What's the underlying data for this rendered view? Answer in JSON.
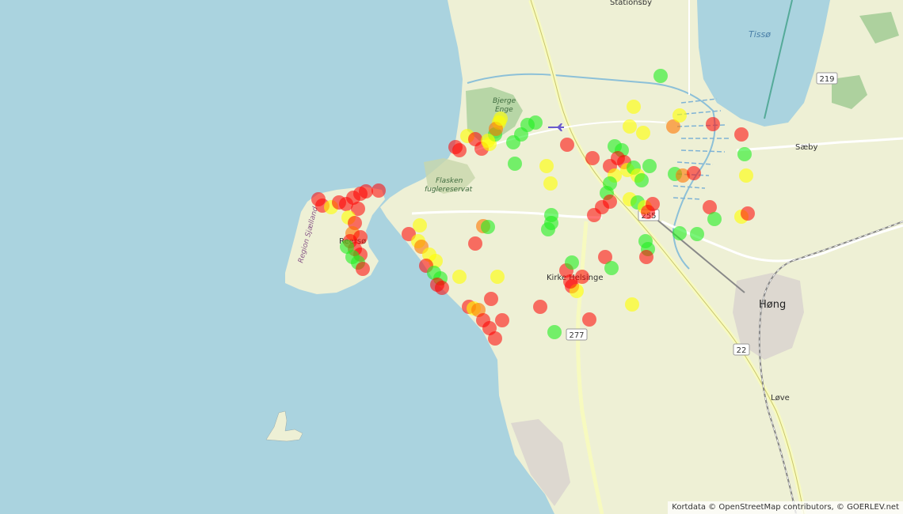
{
  "map": {
    "attribution": "Kortdata © OpenStreetMap contributors, © GOERLEV.net",
    "water_labels": {
      "tisso": "Tissø"
    },
    "place_labels": {
      "stationsby": "Stationsby",
      "bjerge_enge_1": "Bjerge",
      "bjerge_enge_2": "Enge",
      "flasken_1": "Flasken",
      "flasken_2": "fuglereservat",
      "region": "Region Sjælland",
      "reerso": "Reersø",
      "kirke_helsinge": "Kirke Helsinge",
      "saeby": "Sæby",
      "hong": "Høng",
      "love": "Løve"
    },
    "road_shields": {
      "r219": "219",
      "r255": "255",
      "r277": "277",
      "r22": "22"
    },
    "colors": {
      "sea": "#aad3df",
      "land": "#eef0d5",
      "marker_red": "#ff0000",
      "marker_orange": "#ff7700",
      "marker_yellow": "#ffff00",
      "marker_green": "#22ee22"
    }
  }
}
